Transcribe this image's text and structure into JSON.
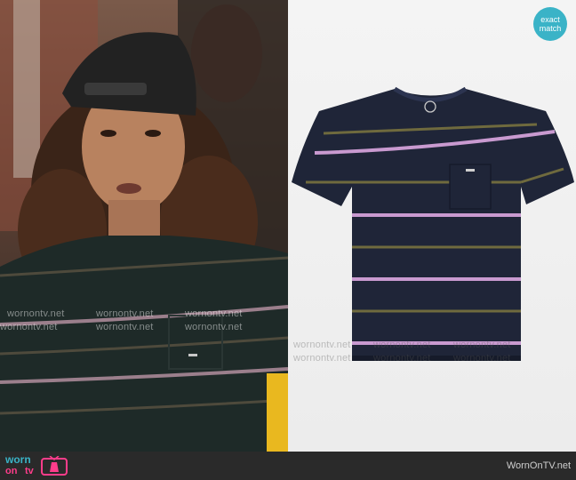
{
  "badge": {
    "line1": "exact",
    "line2": "match",
    "color": "#3ab3c7"
  },
  "watermark": {
    "text": "wornontv.net"
  },
  "brand": {
    "worn": "worn",
    "on": "on",
    "tv": "tv",
    "icon": "tv-dress-icon"
  },
  "footer": {
    "site": "WornOnTV.net"
  },
  "colors": {
    "shirt_navy": "#1f2538",
    "stripe_pink": "#c99ad0",
    "stripe_olive": "#6f6a3e",
    "brand_teal": "#3ab3c7",
    "brand_pink": "#ff3d8b"
  }
}
